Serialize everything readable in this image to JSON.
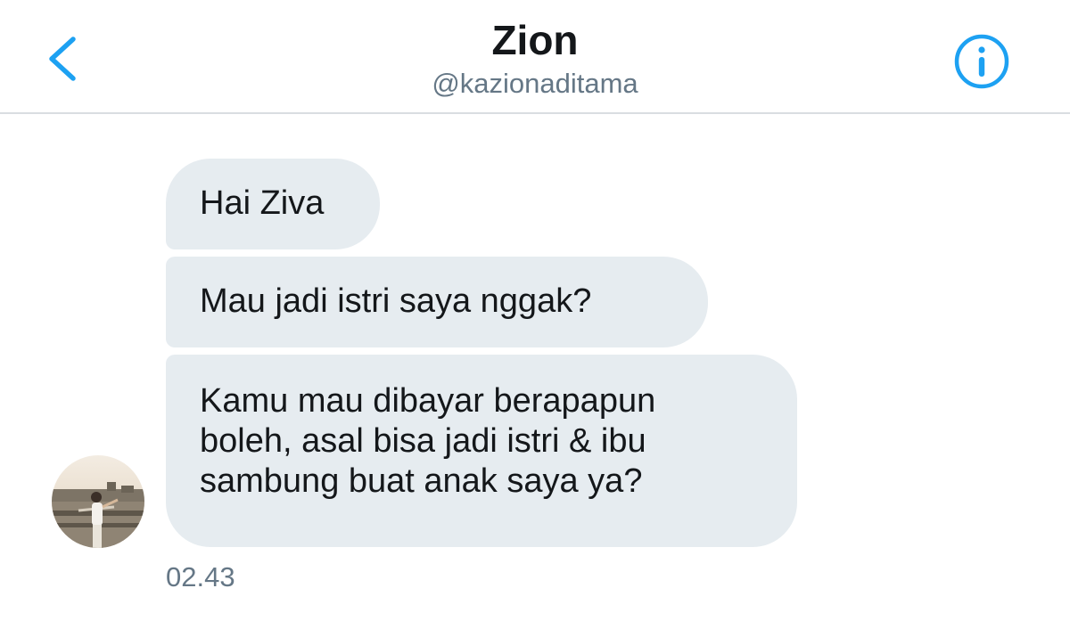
{
  "header": {
    "name": "Zion",
    "handle": "@kazionaditama",
    "back_icon": "chevron-left-icon",
    "info_icon": "info-circle-icon",
    "accent_color": "#1da1f2"
  },
  "messages": [
    {
      "text": "Hai Ziva"
    },
    {
      "text": "Mau jadi istri saya nggak?"
    },
    {
      "lines": [
        "Kamu mau dibayar berapapun",
        "boleh, asal bisa jadi istri & ibu",
        "sambung buat anak saya ya?"
      ]
    }
  ],
  "timestamp": "02.43",
  "colors": {
    "bubble_bg": "#e6ecf0",
    "text_primary": "#14171a",
    "text_secondary": "#657786",
    "divider": "#d9dde1"
  }
}
